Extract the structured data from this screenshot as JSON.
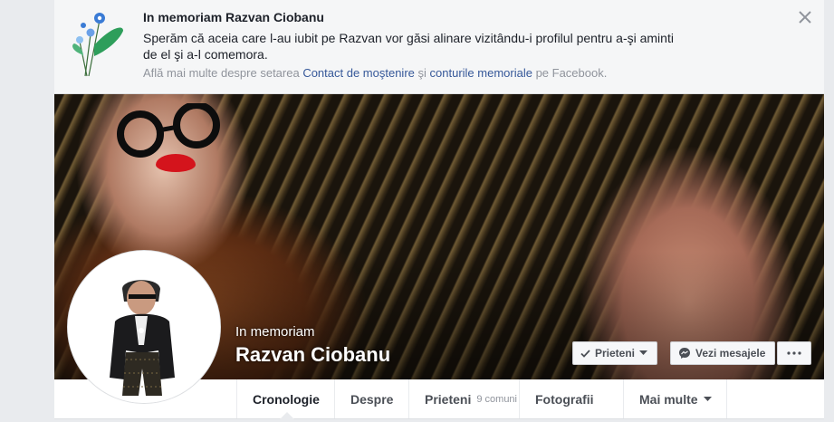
{
  "banner": {
    "title": "In memoriam Razvan Ciobanu",
    "text": "Sperăm că aceia care l-au iubit pe Razvan vor găsi alinare vizitându-i profilul pentru a-şi aminti de el şi a-l comemora.",
    "note_prefix": "Află mai multe despre setarea ",
    "note_link1": "Contact de moştenire",
    "note_mid": " şi ",
    "note_link2": "conturile memoriale",
    "note_suffix": " pe Facebook."
  },
  "cover": {
    "label": "In memoriam",
    "name": "Razvan Ciobanu"
  },
  "buttons": {
    "friends": "Prieteni",
    "messages": "Vezi mesajele"
  },
  "tabs": {
    "timeline": "Cronologie",
    "about": "Despre",
    "friends": "Prieteni",
    "friends_sub": "9 comuni",
    "photos": "Fotografii",
    "more": "Mai multe"
  },
  "colors": {
    "link": "#365899",
    "text": "#1d2129",
    "muted": "#90949c"
  }
}
